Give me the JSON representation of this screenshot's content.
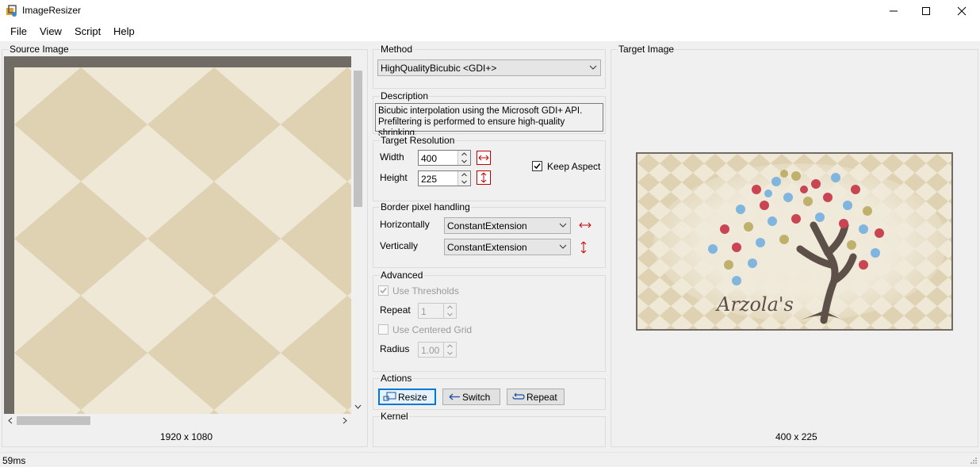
{
  "window": {
    "title": "ImageResizer"
  },
  "menu": [
    "File",
    "View",
    "Script",
    "Help"
  ],
  "source": {
    "group_title": "Source Image",
    "size_label": "1920 x 1080"
  },
  "target": {
    "group_title": "Target Image",
    "size_label": "400 x 225",
    "image_text": "Arzola's"
  },
  "method": {
    "group_title": "Method",
    "selected": "HighQualityBicubic <GDI+>"
  },
  "description": {
    "group_title": "Description",
    "line1": "Bicubic interpolation using the Microsoft GDI+ API.",
    "line2": "Prefiltering is performed to ensure high-quality shrinking."
  },
  "resolution": {
    "group_title": "Target Resolution",
    "width_label": "Width",
    "width_value": "400",
    "height_label": "Height",
    "height_value": "225",
    "keep_aspect_label": "Keep Aspect",
    "keep_aspect_checked": true
  },
  "border": {
    "group_title": "Border pixel handling",
    "h_label": "Horizontally",
    "h_value": "ConstantExtension",
    "v_label": "Vertically",
    "v_value": "ConstantExtension"
  },
  "advanced": {
    "group_title": "Advanced",
    "use_thresholds_label": "Use Thresholds",
    "repeat_label": "Repeat",
    "repeat_value": "1",
    "use_centered_grid_label": "Use Centered Grid",
    "radius_label": "Radius",
    "radius_value": "1.00"
  },
  "actions": {
    "group_title": "Actions",
    "resize_label": "Resize",
    "switch_label": "Switch",
    "repeat_label": "Repeat"
  },
  "kernel": {
    "group_title": "Kernel"
  },
  "status": {
    "time": "59ms"
  },
  "colors": {
    "accent": "#0078d7",
    "tile_light": "#efe8d6",
    "tile_dark": "#dfd2b2",
    "frame": "#706b64"
  }
}
